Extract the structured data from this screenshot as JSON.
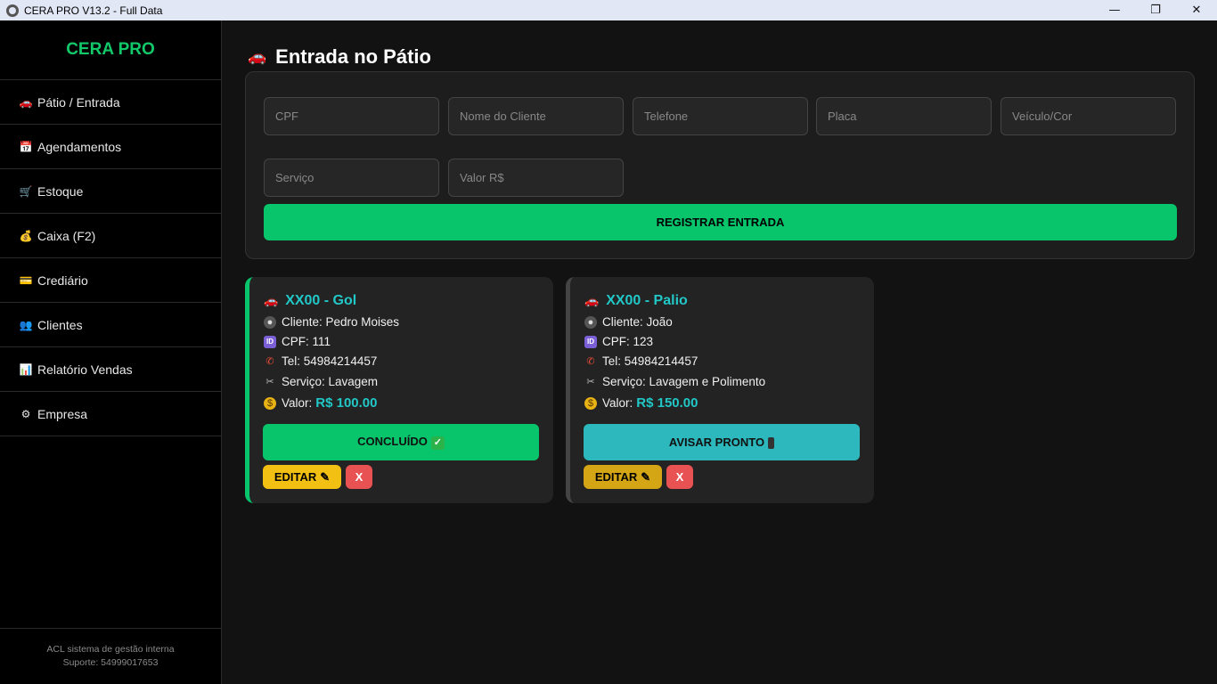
{
  "window": {
    "title": "CERA PRO V13.2 - Full Data",
    "minimize": "—",
    "maximize": "❐",
    "close": "✕"
  },
  "sidebar": {
    "brand": "CERA PRO",
    "items": [
      {
        "icon": "🚗",
        "label": "Pátio / Entrada"
      },
      {
        "icon": "📅",
        "label": "Agendamentos"
      },
      {
        "icon": "🛒",
        "label": "Estoque"
      },
      {
        "icon": "💰",
        "label": "Caixa (F2)"
      },
      {
        "icon": "💳",
        "label": "Crediário"
      },
      {
        "icon": "👥",
        "label": "Clientes"
      },
      {
        "icon": "📊",
        "label": "Relatório Vendas"
      },
      {
        "icon": "⚙",
        "label": "Empresa"
      }
    ],
    "footer_line1": "ACL sistema de gestão interna",
    "footer_line2": "Suporte: 54999017653"
  },
  "page": {
    "title": "Entrada no Pátio",
    "title_icon": "🚗"
  },
  "form": {
    "cpf_placeholder": "CPF",
    "name_placeholder": "Nome do Cliente",
    "phone_placeholder": "Telefone",
    "plate_placeholder": "Placa",
    "vehicle_placeholder": "Veículo/Cor",
    "service_placeholder": "Serviço",
    "value_placeholder": "Valor R$",
    "submit_label": "REGISTRAR ENTRADA"
  },
  "cards": [
    {
      "title": "XX00 - Gol",
      "client": "Cliente: Pedro Moises",
      "cpf": "CPF: 111",
      "tel": "Tel: 54984214457",
      "service": "Serviço: Lavagem",
      "value_label": "Valor:",
      "value": "R$ 100.00",
      "action_label": "CONCLUÍDO",
      "action_color": "#08c46b",
      "border_color": "#08c46b",
      "edit_label": "EDITAR",
      "edit_color": "#f2c012",
      "delete_label": "X"
    },
    {
      "title": "XX00 - Palio",
      "client": "Cliente: João",
      "cpf": "CPF: 123",
      "tel": "Tel: 54984214457",
      "service": "Serviço: Lavagem e Polimento",
      "value_label": "Valor:",
      "value": "R$ 150.00",
      "action_label": "AVISAR PRONTO",
      "action_color": "#2cb8bc",
      "border_color": "#444444",
      "edit_label": "EDITAR",
      "edit_color": "#d4a514",
      "delete_label": "X"
    }
  ]
}
